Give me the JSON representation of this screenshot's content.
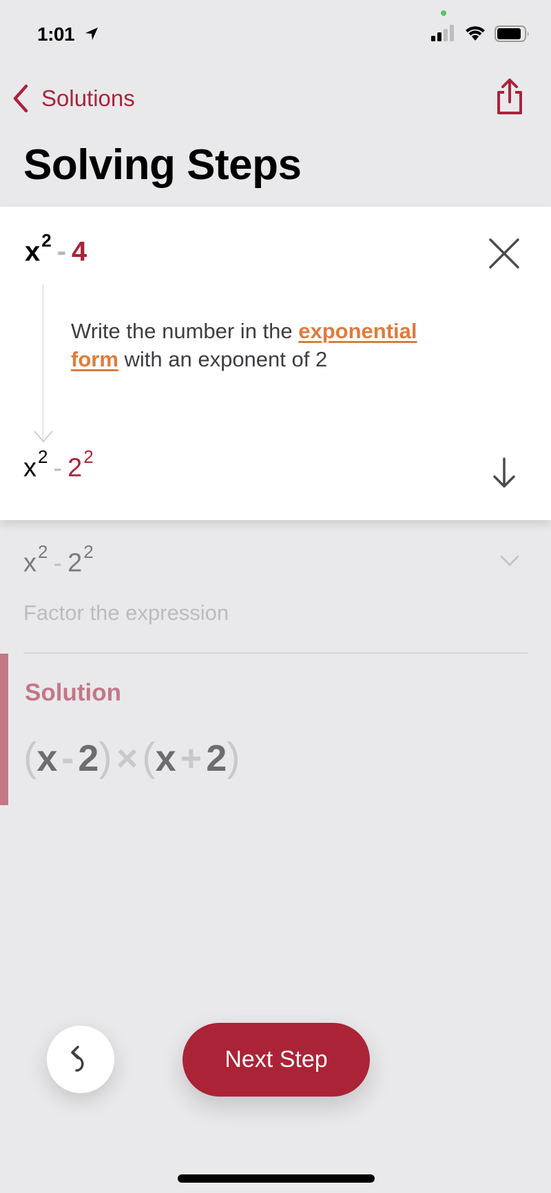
{
  "status_bar": {
    "time": "1:01",
    "icons": [
      "location-arrow-icon",
      "camera-indicator-dot",
      "cellular-signal-icon",
      "wifi-icon",
      "battery-icon"
    ],
    "indicator_color": "#5ac26a"
  },
  "nav": {
    "back_label": "Solutions",
    "back_icon": "chevron-left-icon",
    "share_icon": "share-icon"
  },
  "header": {
    "title": "Solving Steps"
  },
  "current_step": {
    "expression_before": {
      "base": "x",
      "exponent": "2",
      "operator": "-",
      "term": "4"
    },
    "description_prefix": "Write the number in the ",
    "description_link": "exponential form",
    "description_suffix": " with an exponent of 2",
    "expression_after": {
      "base": "x",
      "exponent": "2",
      "operator": "-",
      "term_base": "2",
      "term_exponent": "2"
    },
    "close_icon": "close-icon",
    "expand_icon": "down-arrow-icon"
  },
  "collapsed_step": {
    "expression": {
      "base": "x",
      "exponent": "2",
      "operator": "-",
      "term_base": "2",
      "term_exponent": "2"
    },
    "description": "Factor the expression",
    "icon": "chevron-down-icon"
  },
  "solution": {
    "label": "Solution",
    "parts": {
      "open1": "(",
      "var1": "x",
      "op1": "-",
      "num1": "2",
      "close1": ")",
      "times": "×",
      "open2": "(",
      "var2": "x",
      "op2": "+",
      "num2": "2",
      "close2": ")"
    }
  },
  "actions": {
    "undo_icon": "undo-icon",
    "next_step_label": "Next Step"
  },
  "colors": {
    "accent": "#a8243a",
    "button": "#ab2336",
    "link": "#e07b3a",
    "solution_accent": "#c47787",
    "background": "#e9e9eb"
  }
}
